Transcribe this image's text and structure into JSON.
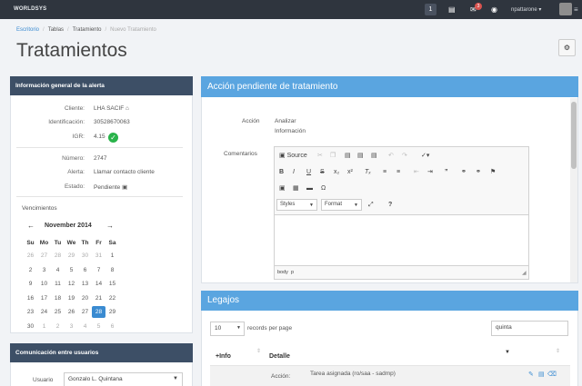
{
  "topbar": {
    "brand": "WORLDSYS",
    "buttons": [
      "1"
    ],
    "badge_count": "3",
    "username": "npattarone"
  },
  "breadcrumb": [
    "Escritorio",
    "Tablas",
    "Tratamiento",
    "Nuevo Tratamiento"
  ],
  "page_title": "Tratamientos",
  "alert_panel": {
    "title": "Información general de la alerta",
    "fields": [
      {
        "label": "Cliente:",
        "value": "LHA SACIF"
      },
      {
        "label": "Identificación:",
        "value": "30528670063"
      },
      {
        "label": "IGR:",
        "value": "4.15"
      },
      {
        "label": "Número:",
        "value": "2747"
      },
      {
        "label": "Alerta:",
        "value": "Llamar contacto cliente"
      },
      {
        "label": "Estado:",
        "value": "Pendiente"
      }
    ],
    "vencimientos_label": "Vencimientos",
    "calendar": {
      "month": "November 2014",
      "weekdays": [
        "Su",
        "Mo",
        "Tu",
        "We",
        "Th",
        "Fr",
        "Sa"
      ],
      "weeks": [
        [
          "26",
          "27",
          "28",
          "29",
          "30",
          "31",
          "1"
        ],
        [
          "2",
          "3",
          "4",
          "5",
          "6",
          "7",
          "8"
        ],
        [
          "9",
          "10",
          "11",
          "12",
          "13",
          "14",
          "15"
        ],
        [
          "16",
          "17",
          "18",
          "19",
          "20",
          "21",
          "22"
        ],
        [
          "23",
          "24",
          "25",
          "26",
          "27",
          "28",
          "29"
        ],
        [
          "30",
          "1",
          "2",
          "3",
          "4",
          "5",
          "6"
        ]
      ],
      "selected": "28"
    }
  },
  "comm_panel": {
    "title": "Comunicación entre usuarios",
    "usuario_label": "Usuario",
    "usuario_value": "Gonzalo L. Quintana"
  },
  "action_panel": {
    "title": "Acción pendiente de tratamiento",
    "accion_label": "Acción",
    "accion_values": [
      "Analizar",
      "Información"
    ],
    "comentarios_label": "Comentarios",
    "editor": {
      "source_label": "Source",
      "styles_label": "Styles",
      "format_label": "Format",
      "path": [
        "body",
        "p"
      ]
    }
  },
  "legajos_panel": {
    "title": "Legajos",
    "page_size": "10",
    "records_per_page": "records per page",
    "search_value": "quinta",
    "columns": [
      "+Info",
      "Detalle"
    ],
    "rows": [
      {
        "label": "Acción:",
        "detail": "Tarea asignada (ro/saa - sadmp)"
      }
    ]
  }
}
